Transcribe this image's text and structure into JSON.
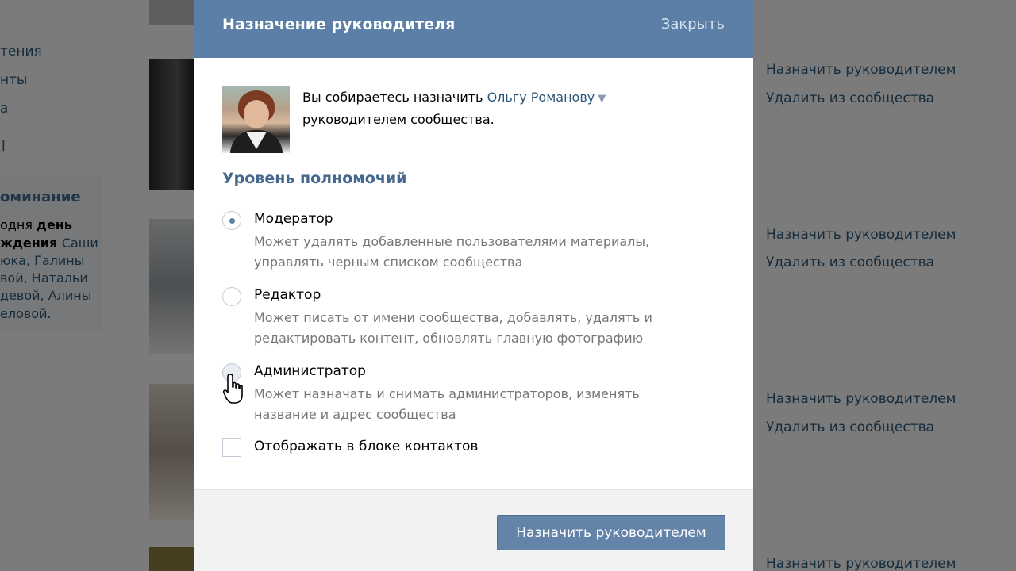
{
  "background": {
    "left_items": [
      "тения",
      "нты",
      "а",
      "]"
    ],
    "reminder": {
      "title": "оминание",
      "lines": [
        {
          "text": "одня ",
          "link": "день"
        },
        {
          "text": "ждения ",
          "link": "Саши"
        },
        {
          "text": "юка, Галины",
          "link": ""
        },
        {
          "text": "вой, Натальи",
          "link": ""
        },
        {
          "text": "девой, Алины",
          "link": ""
        },
        {
          "text": "еловой.",
          "link": ""
        }
      ]
    },
    "rows": [
      {
        "assign": "Назначить руководителем",
        "remove": "Удалить из сообщества"
      },
      {
        "assign": "Назначить руководителем",
        "remove": "Удалить из сообщества"
      },
      {
        "assign": "Назначить руководителем",
        "remove": "Удалить из сообщества"
      },
      {
        "assign": "Назначить руководителем"
      }
    ]
  },
  "modal": {
    "title": "Назначение руководителя",
    "close_label": "Закрыть",
    "intro_prefix": "Вы собираетесь назначить ",
    "user_name": "Ольгу Романову",
    "dropdown_arrow": "▼",
    "intro_suffix": "руководителем сообщества.",
    "section_title": "Уровень полномочий",
    "roles": [
      {
        "name": "Модератор",
        "description": "Может удалять добавленные пользователями материалы, управлять черным списком сообщества",
        "selected": true
      },
      {
        "name": "Редактор",
        "description": "Может писать от имени сообщества, добавлять, удалять и редактировать контент, обновлять главную фотографию",
        "selected": false
      },
      {
        "name": "Администратор",
        "description": "Может назначать и снимать администраторов, изменять название и адрес сообщества",
        "selected": false
      }
    ],
    "contacts_label": "Отображать в блоке контактов",
    "contacts_checked": false,
    "submit_label": "Назначить руководителем"
  },
  "colors": {
    "header": "#5b7fa6",
    "link": "#2b587a",
    "section_title": "#45688e",
    "button": "#6383a8"
  },
  "icons": {
    "cursor": "hand-pointer-icon",
    "dropdown": "triangle-down-icon"
  }
}
